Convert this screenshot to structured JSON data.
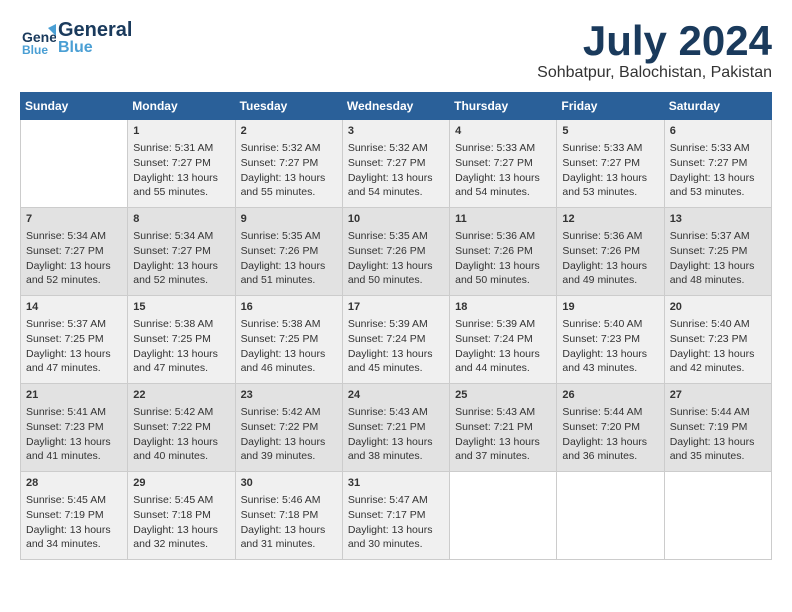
{
  "logo": {
    "line1": "General",
    "line2": "Blue",
    "tagline": ""
  },
  "title": {
    "month_year": "July 2024",
    "location": "Sohbatpur, Balochistan, Pakistan"
  },
  "days_of_week": [
    "Sunday",
    "Monday",
    "Tuesday",
    "Wednesday",
    "Thursday",
    "Friday",
    "Saturday"
  ],
  "weeks": [
    [
      {
        "day": "",
        "content": ""
      },
      {
        "day": "1",
        "content": "Sunrise: 5:31 AM\nSunset: 7:27 PM\nDaylight: 13 hours\nand 55 minutes."
      },
      {
        "day": "2",
        "content": "Sunrise: 5:32 AM\nSunset: 7:27 PM\nDaylight: 13 hours\nand 55 minutes."
      },
      {
        "day": "3",
        "content": "Sunrise: 5:32 AM\nSunset: 7:27 PM\nDaylight: 13 hours\nand 54 minutes."
      },
      {
        "day": "4",
        "content": "Sunrise: 5:33 AM\nSunset: 7:27 PM\nDaylight: 13 hours\nand 54 minutes."
      },
      {
        "day": "5",
        "content": "Sunrise: 5:33 AM\nSunset: 7:27 PM\nDaylight: 13 hours\nand 53 minutes."
      },
      {
        "day": "6",
        "content": "Sunrise: 5:33 AM\nSunset: 7:27 PM\nDaylight: 13 hours\nand 53 minutes."
      }
    ],
    [
      {
        "day": "7",
        "content": "Sunrise: 5:34 AM\nSunset: 7:27 PM\nDaylight: 13 hours\nand 52 minutes."
      },
      {
        "day": "8",
        "content": "Sunrise: 5:34 AM\nSunset: 7:27 PM\nDaylight: 13 hours\nand 52 minutes."
      },
      {
        "day": "9",
        "content": "Sunrise: 5:35 AM\nSunset: 7:26 PM\nDaylight: 13 hours\nand 51 minutes."
      },
      {
        "day": "10",
        "content": "Sunrise: 5:35 AM\nSunset: 7:26 PM\nDaylight: 13 hours\nand 50 minutes."
      },
      {
        "day": "11",
        "content": "Sunrise: 5:36 AM\nSunset: 7:26 PM\nDaylight: 13 hours\nand 50 minutes."
      },
      {
        "day": "12",
        "content": "Sunrise: 5:36 AM\nSunset: 7:26 PM\nDaylight: 13 hours\nand 49 minutes."
      },
      {
        "day": "13",
        "content": "Sunrise: 5:37 AM\nSunset: 7:25 PM\nDaylight: 13 hours\nand 48 minutes."
      }
    ],
    [
      {
        "day": "14",
        "content": "Sunrise: 5:37 AM\nSunset: 7:25 PM\nDaylight: 13 hours\nand 47 minutes."
      },
      {
        "day": "15",
        "content": "Sunrise: 5:38 AM\nSunset: 7:25 PM\nDaylight: 13 hours\nand 47 minutes."
      },
      {
        "day": "16",
        "content": "Sunrise: 5:38 AM\nSunset: 7:25 PM\nDaylight: 13 hours\nand 46 minutes."
      },
      {
        "day": "17",
        "content": "Sunrise: 5:39 AM\nSunset: 7:24 PM\nDaylight: 13 hours\nand 45 minutes."
      },
      {
        "day": "18",
        "content": "Sunrise: 5:39 AM\nSunset: 7:24 PM\nDaylight: 13 hours\nand 44 minutes."
      },
      {
        "day": "19",
        "content": "Sunrise: 5:40 AM\nSunset: 7:23 PM\nDaylight: 13 hours\nand 43 minutes."
      },
      {
        "day": "20",
        "content": "Sunrise: 5:40 AM\nSunset: 7:23 PM\nDaylight: 13 hours\nand 42 minutes."
      }
    ],
    [
      {
        "day": "21",
        "content": "Sunrise: 5:41 AM\nSunset: 7:23 PM\nDaylight: 13 hours\nand 41 minutes."
      },
      {
        "day": "22",
        "content": "Sunrise: 5:42 AM\nSunset: 7:22 PM\nDaylight: 13 hours\nand 40 minutes."
      },
      {
        "day": "23",
        "content": "Sunrise: 5:42 AM\nSunset: 7:22 PM\nDaylight: 13 hours\nand 39 minutes."
      },
      {
        "day": "24",
        "content": "Sunrise: 5:43 AM\nSunset: 7:21 PM\nDaylight: 13 hours\nand 38 minutes."
      },
      {
        "day": "25",
        "content": "Sunrise: 5:43 AM\nSunset: 7:21 PM\nDaylight: 13 hours\nand 37 minutes."
      },
      {
        "day": "26",
        "content": "Sunrise: 5:44 AM\nSunset: 7:20 PM\nDaylight: 13 hours\nand 36 minutes."
      },
      {
        "day": "27",
        "content": "Sunrise: 5:44 AM\nSunset: 7:19 PM\nDaylight: 13 hours\nand 35 minutes."
      }
    ],
    [
      {
        "day": "28",
        "content": "Sunrise: 5:45 AM\nSunset: 7:19 PM\nDaylight: 13 hours\nand 34 minutes."
      },
      {
        "day": "29",
        "content": "Sunrise: 5:45 AM\nSunset: 7:18 PM\nDaylight: 13 hours\nand 32 minutes."
      },
      {
        "day": "30",
        "content": "Sunrise: 5:46 AM\nSunset: 7:18 PM\nDaylight: 13 hours\nand 31 minutes."
      },
      {
        "day": "31",
        "content": "Sunrise: 5:47 AM\nSunset: 7:17 PM\nDaylight: 13 hours\nand 30 minutes."
      },
      {
        "day": "",
        "content": ""
      },
      {
        "day": "",
        "content": ""
      },
      {
        "day": "",
        "content": ""
      }
    ]
  ]
}
